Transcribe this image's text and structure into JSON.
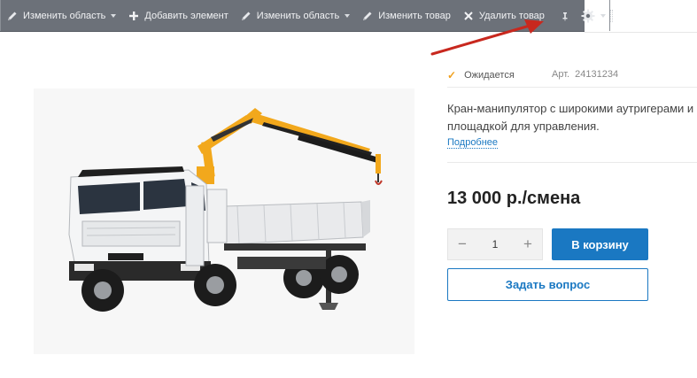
{
  "admin_bar": {
    "items": [
      {
        "label": "Изменить область",
        "icon": "pencil-icon",
        "has_caret": true
      },
      {
        "label": "Добавить элемент",
        "icon": "plus-icon",
        "has_caret": false
      },
      {
        "label": "Изменить область",
        "icon": "pencil-icon",
        "has_caret": true
      },
      {
        "label": "Изменить товар",
        "icon": "pencil-icon",
        "has_caret": false
      },
      {
        "label": "Удалить товар",
        "icon": "x-icon",
        "has_caret": false
      }
    ],
    "pin_icon": "pin-icon",
    "settings_icon": "gear-icon",
    "colors": {
      "background": "#6c7179",
      "text": "#f2f3f5"
    }
  },
  "annotation_arrow": {
    "color": "#c8281e"
  },
  "product": {
    "image_icon": "crane-truck-image",
    "availability": {
      "icon": "check-icon",
      "label": "Ожидается",
      "color": "#f0a01e"
    },
    "article": {
      "label": "Арт.",
      "value": "24131234"
    },
    "description": "Кран-манипулятор с широкими аутригерами и площадкой для управления.",
    "more_link": "Подробнее",
    "price": "13 000 р./смена",
    "quantity": {
      "minus": "−",
      "value": "1",
      "plus": "+"
    },
    "cart_button": "В корзину",
    "ask_button": "Задать вопрос",
    "accent_color": "#1a78c2"
  }
}
